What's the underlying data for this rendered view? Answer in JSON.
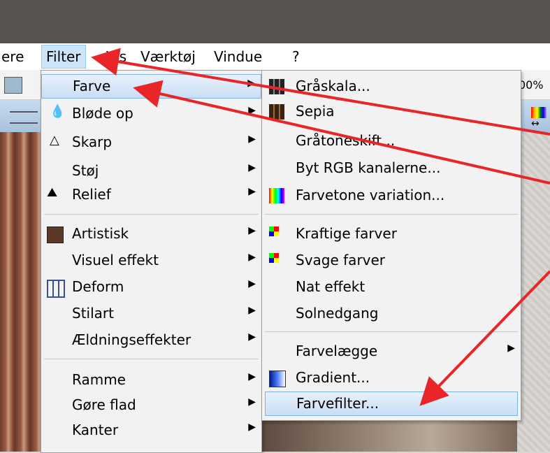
{
  "menubar": {
    "items": [
      "ere",
      "Filter",
      "Vis",
      "Værktøj",
      "Vindue",
      "?"
    ]
  },
  "toolbar": {
    "zoom_text": "00%"
  },
  "filter_menu": {
    "items": [
      {
        "label": "Farve",
        "icon": "none"
      },
      {
        "label": "Bløde op",
        "icon": "drop-icon"
      },
      {
        "label": "Skarp",
        "icon": "triangle-icon"
      },
      {
        "label": "Støj",
        "icon": "none"
      },
      {
        "label": "Relief",
        "icon": "relief-icon"
      },
      {
        "label": "Artistisk",
        "icon": "portrait-icon"
      },
      {
        "label": "Visuel effekt",
        "icon": "none"
      },
      {
        "label": "Deform",
        "icon": "grid-icon"
      },
      {
        "label": "Stilart",
        "icon": "none"
      },
      {
        "label": "Ældningseffekter",
        "icon": "none"
      },
      {
        "label": "Ramme",
        "icon": "none"
      },
      {
        "label": "Gøre flad",
        "icon": "none"
      },
      {
        "label": "Kanter",
        "icon": "none"
      }
    ]
  },
  "farve_menu": {
    "items": [
      {
        "label": "Gråskala...",
        "icon": "grayscale-grid-icon"
      },
      {
        "label": "Sepia",
        "icon": "sepia-grid-icon"
      },
      {
        "label": "Gråtoneskift...",
        "icon": "none"
      },
      {
        "label": "Byt RGB kanalerne...",
        "icon": "none"
      },
      {
        "label": "Farvetone variation...",
        "icon": "hue-variation-icon"
      },
      {
        "label": "Kraftige farver",
        "icon": "color-plus-icon"
      },
      {
        "label": "Svage farver",
        "icon": "color-minus-icon"
      },
      {
        "label": "Nat effekt",
        "icon": "none"
      },
      {
        "label": "Solnedgang",
        "icon": "none"
      },
      {
        "label": "Farvelægge",
        "icon": "none"
      },
      {
        "label": "Gradient...",
        "icon": "gradient-icon"
      },
      {
        "label": "Farvefilter...",
        "icon": "none"
      }
    ]
  },
  "colors": {
    "accent_arrow": "#e8262a",
    "highlight": "#c9def5"
  }
}
